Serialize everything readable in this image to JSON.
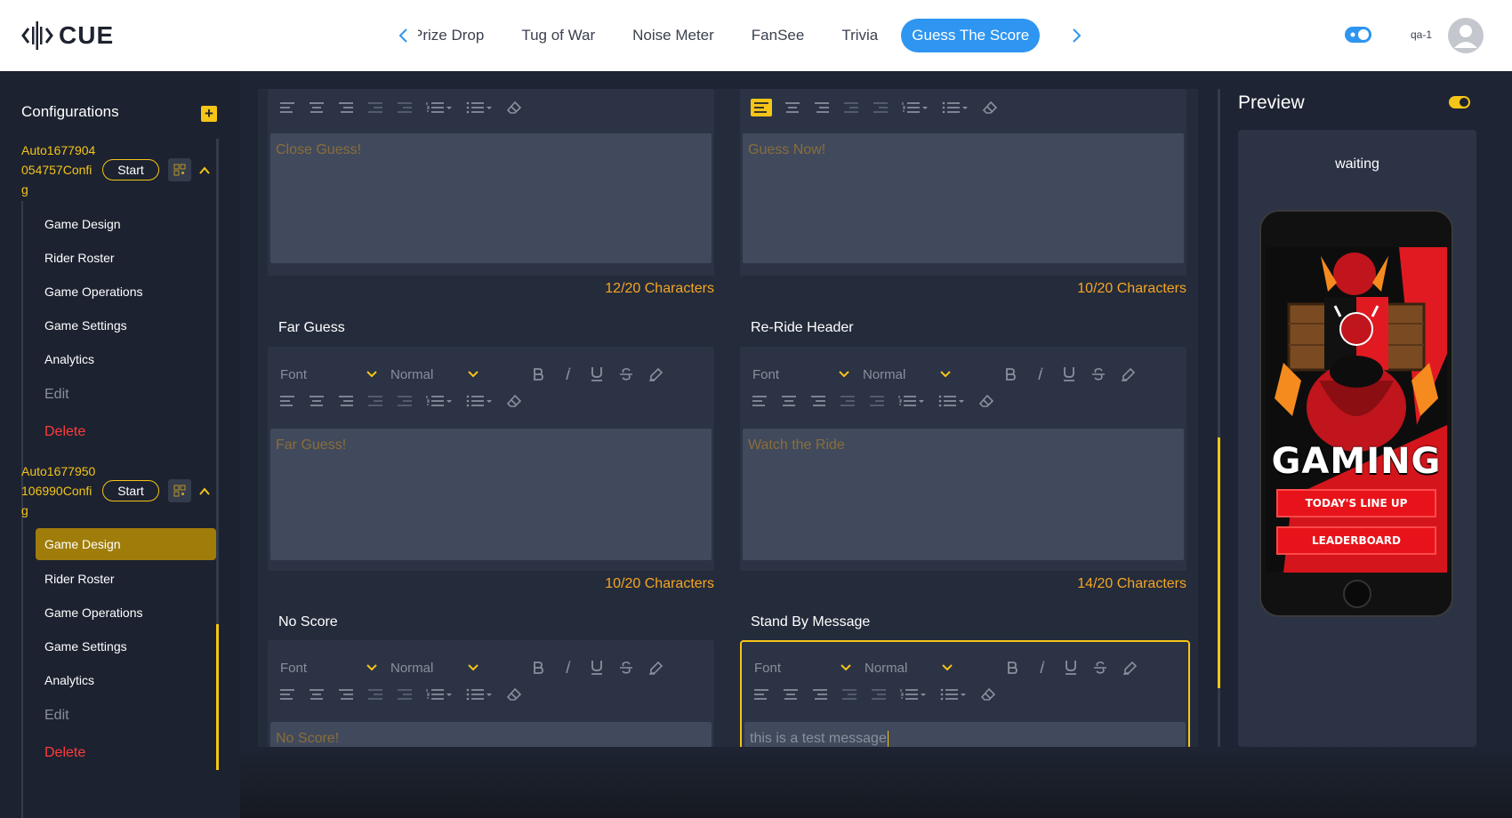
{
  "app": {
    "logo_text": "CUE",
    "user": "qa-1"
  },
  "tabs": [
    {
      "label": "Prize Drop"
    },
    {
      "label": "Tug of War"
    },
    {
      "label": "Noise Meter"
    },
    {
      "label": "FanSee"
    },
    {
      "label": "Trivia"
    },
    {
      "label": "Guess The Score",
      "active": true
    }
  ],
  "sidebar": {
    "title": "Configurations",
    "add_label": "+",
    "configs": [
      {
        "name": "Auto1677904054757Config",
        "start_label": "Start",
        "items": [
          {
            "label": "Game Design"
          },
          {
            "label": "Rider Roster"
          },
          {
            "label": "Game Operations"
          },
          {
            "label": "Game Settings"
          },
          {
            "label": "Analytics"
          },
          {
            "label": "Edit"
          },
          {
            "label": "Delete"
          }
        ]
      },
      {
        "name": "Auto1677950106990Config",
        "start_label": "Start",
        "items": [
          {
            "label": "Game Design",
            "active": true
          },
          {
            "label": "Rider Roster"
          },
          {
            "label": "Game Operations"
          },
          {
            "label": "Game Settings"
          },
          {
            "label": "Analytics"
          },
          {
            "label": "Edit"
          },
          {
            "label": "Delete"
          }
        ]
      }
    ]
  },
  "editor": {
    "font_placeholder": "Font",
    "size_placeholder": "Normal",
    "fields": [
      {
        "title": "",
        "text": "Close Guess!",
        "count": "12/20 Characters"
      },
      {
        "title": "",
        "text": "Guess Now!",
        "count": "10/20 Characters"
      },
      {
        "title": "Far Guess",
        "text": "Far Guess!",
        "count": "10/20 Characters"
      },
      {
        "title": "Re-Ride Header",
        "text": "Watch the Ride",
        "count": "14/20 Characters"
      },
      {
        "title": "No Score",
        "text": "No Score!",
        "count": ""
      },
      {
        "title": "Stand By Message",
        "text": "this is a test message",
        "count": ""
      }
    ]
  },
  "preview": {
    "title": "Preview",
    "status": "waiting",
    "brand_word": "GAMING",
    "badge_text": "GAMING",
    "buttons": [
      "TODAY'S LINE UP",
      "LEADERBOARD"
    ]
  },
  "colors": {
    "accent": "#f5c518",
    "tab_active": "#2e95f0",
    "danger": "#ff3b3b",
    "count": "#f5a623"
  }
}
